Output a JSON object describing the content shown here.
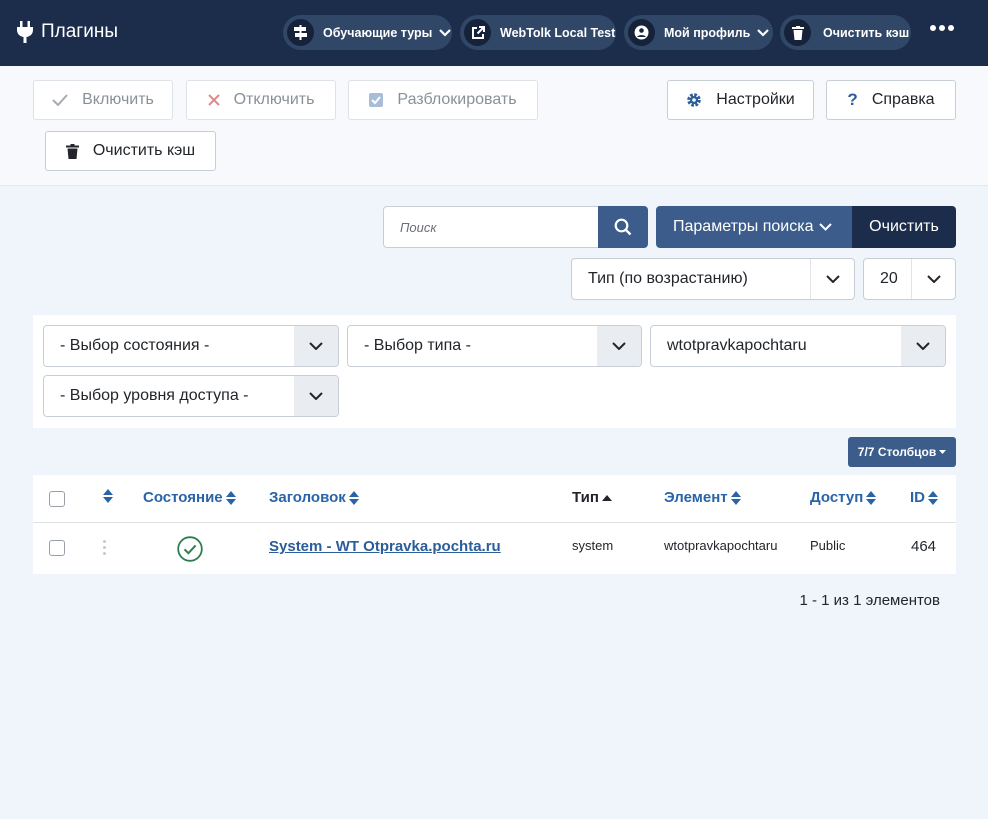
{
  "header": {
    "title": "Плагины",
    "pills": {
      "tours": "Обучающие туры",
      "site": "WebTolk Local Test",
      "profile": "Мой профиль",
      "cache": "Очистить кэш"
    }
  },
  "toolbar": {
    "enable": "Включить",
    "disable": "Отключить",
    "unlock": "Разблокировать",
    "settings": "Настройки",
    "help": "Справка",
    "clear_cache": "Очистить кэш"
  },
  "search": {
    "placeholder": "Поиск",
    "options_label": "Параметры поиска",
    "clear_label": "Очистить"
  },
  "sort": {
    "order": "Тип (по возрастанию)",
    "limit": "20"
  },
  "filters": {
    "state": "- Выбор состояния -",
    "type": "- Выбор типа -",
    "element": "wtotpravkapochtaru",
    "access": "- Выбор уровня доступа -"
  },
  "columns_button": "7/7 Столбцов",
  "table": {
    "headers": {
      "state": "Состояние",
      "title": "Заголовок",
      "type": "Тип",
      "element": "Элемент",
      "access": "Доступ",
      "id": "ID"
    },
    "rows": [
      {
        "enabled": true,
        "title": "System - WT Otpravka.pochta.ru",
        "type": "system",
        "element": "wtotpravkapochtaru",
        "access": "Public",
        "id": "464"
      }
    ]
  },
  "pagination_text": "1 - 1 из 1 элементов",
  "colors": {
    "header_bg": "#1c2d4b",
    "primary": "#3c5d8c",
    "link": "#2a5d9a",
    "success": "#2e7d4f"
  },
  "icons": [
    "plug-icon",
    "signpost-icon",
    "external-link-icon",
    "user-icon",
    "trash-icon",
    "more-icon",
    "check-icon",
    "times-icon",
    "unlock-icon",
    "gear-icon",
    "question-icon",
    "search-icon",
    "chevron-down-icon",
    "sort-icon",
    "check-circle-icon"
  ]
}
